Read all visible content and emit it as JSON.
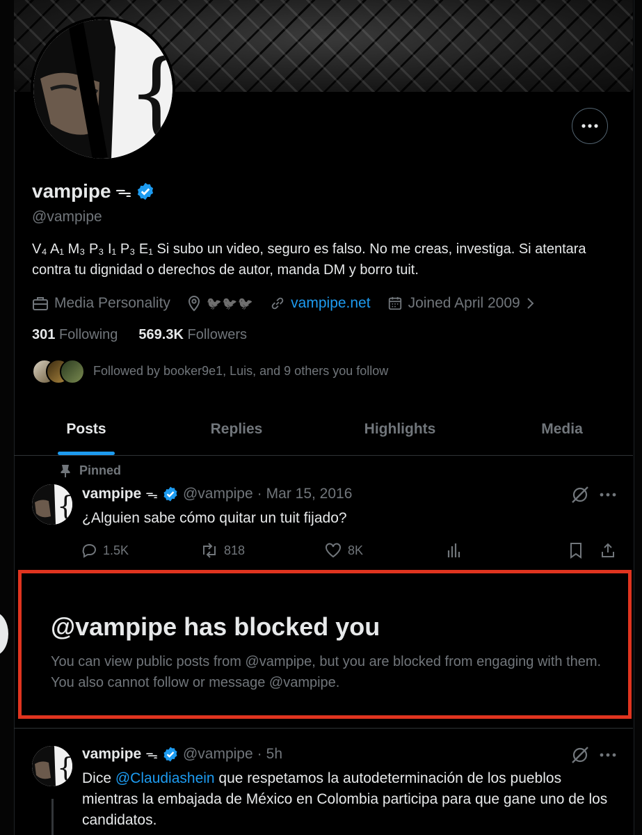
{
  "profile": {
    "display_name": "vampipe",
    "name_suffix": "ᯓ",
    "handle": "@vampipe",
    "bio": "V₄ A₁ M₃ P₃ I₁ P₃ E₁ Si subo un video, seguro es falso. No me creas, investiga. Si atentara contra tu dignidad o derechos de autor, manda DM y borro tuit.",
    "category": "Media Personality",
    "location": "🐦🐦🐦",
    "website": "vampipe.net",
    "joined": "Joined April 2009",
    "following_count": "301",
    "following_label": "Following",
    "followers_count": "569.3K",
    "followers_label": "Followers",
    "followed_by": "Followed by booker9e1, Luis, and 9 others you follow",
    "verified_color": "#1d9bf0"
  },
  "tabs": [
    {
      "label": "Posts",
      "active": true
    },
    {
      "label": "Replies",
      "active": false
    },
    {
      "label": "Highlights",
      "active": false
    },
    {
      "label": "Media",
      "active": false
    }
  ],
  "pinned_tweet": {
    "pinned_label": "Pinned",
    "name": "vampipe",
    "name_suffix": "ᯓ",
    "handle": "@vampipe",
    "sep": "·",
    "date": "Mar 15, 2016",
    "text": "¿Alguien sabe cómo quitar un tuit fijado?",
    "replies": "1.5K",
    "retweets": "818",
    "likes": "8K"
  },
  "blocked_notice": {
    "title": "@vampipe has blocked you",
    "description": "You can view public posts from @vampipe, but you are blocked from engaging with them. You also cannot follow or message @vampipe.",
    "highlight_color": "#e0341f"
  },
  "second_tweet": {
    "name": "vampipe",
    "name_suffix": "ᯓ",
    "handle": "@vampipe",
    "sep": "·",
    "time": "5h",
    "text_before": "Dice ",
    "mention": "@Claudiashein",
    "text_after": " que respetamos la autodeterminación de los pueblos mientras la embajada de México en Colombia participa para que gane uno de los candidatos."
  },
  "icons": [
    "more-icon",
    "verified-badge-icon",
    "briefcase-icon",
    "location-pin-icon",
    "link-icon",
    "calendar-icon",
    "chevron-right-icon",
    "pin-icon",
    "grok-icon",
    "reply-icon",
    "retweet-icon",
    "like-icon",
    "views-icon",
    "bookmark-icon",
    "share-icon"
  ]
}
